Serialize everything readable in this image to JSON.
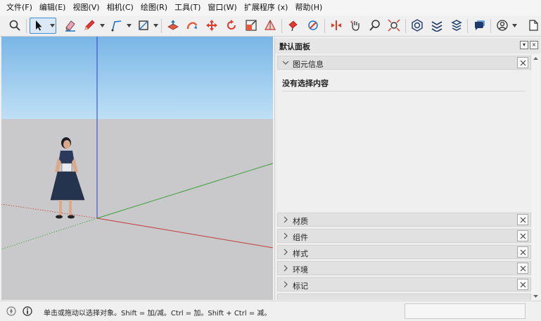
{
  "menubar": {
    "items": [
      "文件(F)",
      "编辑(E)",
      "视图(V)",
      "相机(C)",
      "绘图(R)",
      "工具(T)",
      "窗口(W)",
      "扩展程序 (x)",
      "帮助(H)"
    ]
  },
  "toolbar": {
    "tools": [
      "search-icon",
      "select-arrow-icon",
      "eraser-icon",
      "pencil-icon",
      "line-tool-icon",
      "rectangle-tool-icon",
      "push-pull-icon",
      "follow-me-icon",
      "move-icon",
      "rotate-icon",
      "scale-icon",
      "tape-measure-icon",
      "paint-bucket-icon",
      "orbit-icon",
      "pan-icon",
      "zoom-icon",
      "zoom-extents-icon",
      "warehouse-icon",
      "extension-icon",
      "layers-icon",
      "chat-icon",
      "account-icon",
      "new-file-icon"
    ]
  },
  "colors": {
    "sky": "#a7d3ee",
    "ground": "#c9c9cc",
    "axis_blue": "#2b3fd0",
    "axis_red": "#c43a3a",
    "axis_green": "#3aa03a",
    "accent": "#1e73c8"
  },
  "panel": {
    "title": "默认面板",
    "entity_info": {
      "label": "图元信息",
      "content": "没有选择内容"
    },
    "trays": [
      {
        "label": "材质"
      },
      {
        "label": "组件"
      },
      {
        "label": "样式"
      },
      {
        "label": "环境"
      },
      {
        "label": "标记"
      }
    ]
  },
  "statusbar": {
    "hint": "单击或拖动以选择对象。Shift = 加/减。Ctrl = 加。Shift + Ctrl = 减。",
    "measurement": ""
  }
}
